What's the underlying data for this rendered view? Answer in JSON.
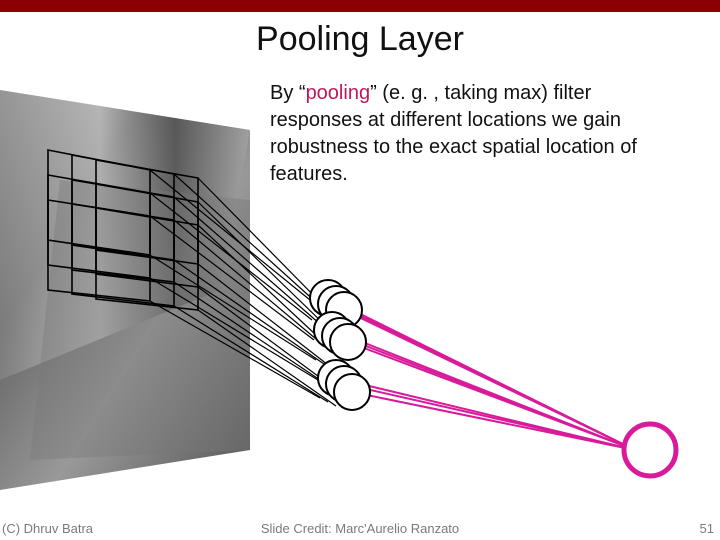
{
  "slide": {
    "title": "Pooling Layer",
    "body_prefix": "By “",
    "body_keyword": "pooling",
    "body_suffix": "” (e. g. , taking max) filter responses at different locations we gain robustness to the exact spatial location of features.",
    "copyright": "(C) Dhruv Batra",
    "credit": "Slide Credit: Marc'Aurelio Ranzato",
    "pagenum": "51"
  },
  "colors": {
    "accent": "#c2185b",
    "bar": "#8b0000"
  }
}
